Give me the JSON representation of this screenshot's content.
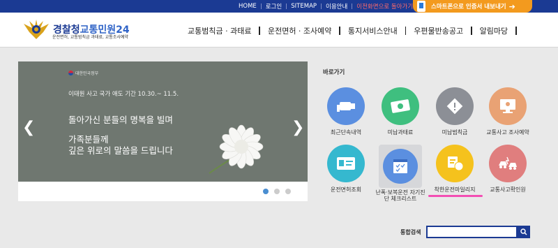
{
  "topbar": {
    "links": [
      "HOME",
      "로그인",
      "SITEMAP",
      "이용안내",
      "이전화면으로 돌아가기"
    ],
    "app_button": "스마트폰으로 인증서 내보내기"
  },
  "logo": {
    "title_main": "경찰청",
    "title_sub": "교통민원24",
    "subtitle": "운전면허, 교통범칙금 과태료, 교통조사예약"
  },
  "gnb": [
    "교통범칙금 · 과태료",
    "운전면허 · 조사예약",
    "통지서비스안내",
    "우편물반송공고",
    "알림마당"
  ],
  "banner": {
    "ministry": "대한민국정부",
    "period": "이태원 사고 국가 애도 기간 10.30.~ 11.5.",
    "line1": "돌아가신 분들의 명복을 빌며",
    "line2": "가족분들께",
    "line3": "깊은 위로의 말씀을 드립니다",
    "active_slide": 1,
    "slide_count": 3
  },
  "quick": {
    "title": "바로가기",
    "items": [
      {
        "label": "최근단속내역",
        "color": "#5b8fe0",
        "icon": "camera-icon"
      },
      {
        "label": "미납과태료",
        "color": "#3fbf7f",
        "icon": "banknote-icon"
      },
      {
        "label": "미납범칙금",
        "color": "#8c8f96",
        "icon": "warning-sign-icon"
      },
      {
        "label": "교통사고 조사예약",
        "color": "#e9a274",
        "icon": "computer-icon"
      },
      {
        "label": "운전면허조회",
        "color": "#35b8cf",
        "icon": "license-card-icon"
      },
      {
        "label": "난폭·보복운전 자기진단 체크리스트",
        "color": "#5b8fe0",
        "icon": "checklist-icon"
      },
      {
        "label": "착한운전마일리지",
        "color": "#f5c21d",
        "icon": "mileage-icon"
      },
      {
        "label": "교통사고확인원",
        "color": "#e07e7e",
        "icon": "car-crash-icon"
      }
    ]
  },
  "search": {
    "label": "통합검색",
    "value": "",
    "button": "search-icon"
  }
}
